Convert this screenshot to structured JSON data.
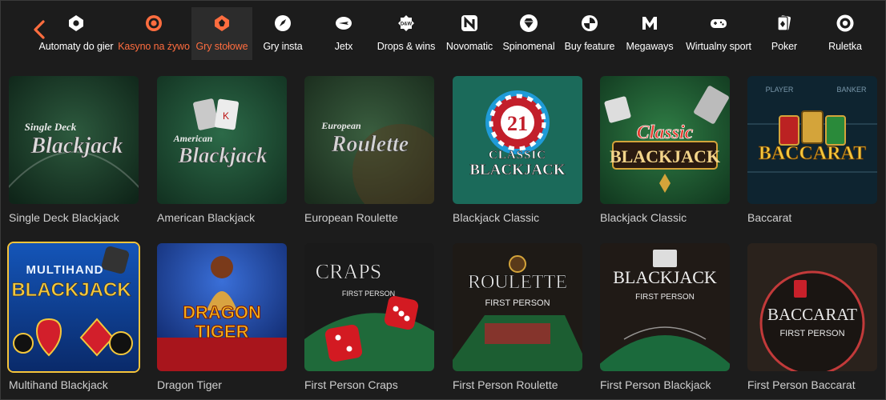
{
  "nav": {
    "items": [
      {
        "label": "Automaty do gier",
        "icon": "slot-machine-icon"
      },
      {
        "label": "Kasyno na żywo",
        "icon": "live-casino-icon"
      },
      {
        "label": "Gry stołowe",
        "icon": "table-games-icon"
      },
      {
        "label": "Gry insta",
        "icon": "rocket-icon"
      },
      {
        "label": "Jetx",
        "icon": "jet-icon"
      },
      {
        "label": "Drops & wins",
        "icon": "drops-wins-icon",
        "badge": "D&W"
      },
      {
        "label": "Novomatic",
        "icon": "novomatic-icon",
        "badge": "N"
      },
      {
        "label": "Spinomenal",
        "icon": "diamond-icon"
      },
      {
        "label": "Buy feature",
        "icon": "buy-feature-icon"
      },
      {
        "label": "Megaways",
        "icon": "megaways-icon",
        "badge": "M"
      },
      {
        "label": "Wirtualny sport",
        "icon": "gamepad-icon"
      },
      {
        "label": "Poker",
        "icon": "cards-icon"
      },
      {
        "label": "Ruletka",
        "icon": "roulette-wheel-icon"
      }
    ],
    "active_index": 2,
    "live_index": 1
  },
  "colors": {
    "accent": "#ff6d3f",
    "background": "#1c1c1c",
    "selected_border": "#f6c43a"
  },
  "games": [
    {
      "title": "Single Deck Blackjack",
      "art_lines": [
        "Single Deck",
        "Blackjack"
      ]
    },
    {
      "title": "American Blackjack",
      "art_lines": [
        "American",
        "Blackjack"
      ]
    },
    {
      "title": "European Roulette",
      "art_lines": [
        "European",
        "Roulette"
      ]
    },
    {
      "title": "Blackjack Classic",
      "art_lines": [
        "21",
        "CLASSIC",
        "BLACKJACK"
      ]
    },
    {
      "title": "Blackjack Classic",
      "art_lines": [
        "Classic",
        "BLACKJACK"
      ]
    },
    {
      "title": "Baccarat",
      "art_lines": [
        "BACCARAT",
        "PLAYER",
        "BANKER"
      ]
    },
    {
      "title": "Multihand Blackjack",
      "art_lines": [
        "MULTIHAND",
        "BLACKJACK"
      ]
    },
    {
      "title": "Dragon Tiger",
      "art_lines": [
        "DRAGON",
        "TIGER"
      ]
    },
    {
      "title": "First Person Craps",
      "art_lines": [
        "CRAPS",
        "FIRST PERSON"
      ]
    },
    {
      "title": "First Person Roulette",
      "art_lines": [
        "ROULETTE",
        "FIRST PERSON"
      ]
    },
    {
      "title": "First Person Blackjack",
      "art_lines": [
        "BLACKJACK",
        "FIRST PERSON"
      ]
    },
    {
      "title": "First Person Baccarat",
      "art_lines": [
        "BACCARAT",
        "FIRST PERSON"
      ]
    }
  ],
  "selected_game_index": 6
}
